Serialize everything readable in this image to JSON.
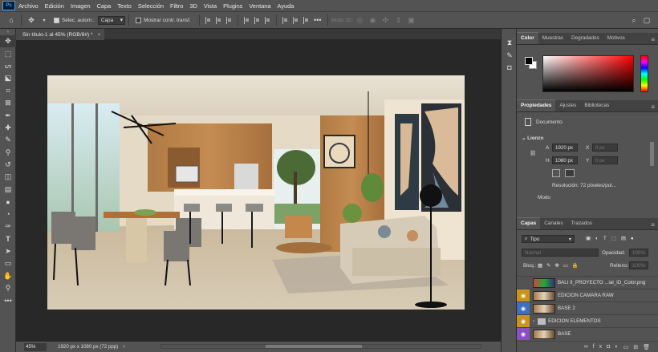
{
  "menu": [
    "Archivo",
    "Edición",
    "Imagen",
    "Capa",
    "Texto",
    "Selección",
    "Filtro",
    "3D",
    "Vista",
    "Plugins",
    "Ventana",
    "Ayuda"
  ],
  "options": {
    "auto_select_label": "Selec. autom.:",
    "auto_select_value": "Capa",
    "transform_label": "Mostrar contr. transf.",
    "mode3d_label": "Modo 3D:"
  },
  "document": {
    "tab_title": "Sin título-1 al 45% (RGB/8#) *",
    "zoom": "45%",
    "size_info": "1920 px x 1080 px (72 ppp)"
  },
  "color_panel": {
    "tabs": [
      "Color",
      "Muestras",
      "Degradados",
      "Motivos"
    ],
    "fg": "#000000",
    "bg": "#ffffff"
  },
  "properties_panel": {
    "tabs": [
      "Propiedades",
      "Ajustes",
      "Bibliotecas"
    ],
    "doc_label": "Documento",
    "section": "Lienzo",
    "w_label": "A",
    "w_value": "1920 px",
    "h_label": "H",
    "h_value": "1080 px",
    "x_label": "X",
    "x_value": "0 px",
    "y_label": "Y",
    "y_value": "0 px",
    "resolution": "Resolución: 72 píxeles/pul...",
    "mode_label": "Modo"
  },
  "layers_panel": {
    "tabs": [
      "Capas",
      "Canales",
      "Trazados"
    ],
    "filter": "Tipo",
    "blend": "Normal",
    "opacity_label": "Opacidad:",
    "opacity_value": "100%",
    "lock_label": "Bloq.:",
    "fill_label": "Relleno:",
    "fill_value": "100%",
    "layers": [
      {
        "name": "BALI II_PROYECTO ...ial_ID_Color.png",
        "eye_color": "#535353",
        "visible": false,
        "type": "image"
      },
      {
        "name": "EDICION CAMARA RAW",
        "eye_color": "#c9931c",
        "visible": true,
        "type": "image"
      },
      {
        "name": "BASE 2",
        "eye_color": "#3e6fc2",
        "visible": true,
        "type": "image"
      },
      {
        "name": "EDICION ELEMENTOS",
        "eye_color": "#c9931c",
        "visible": true,
        "type": "folder"
      },
      {
        "name": "BASE",
        "eye_color": "#8b4fc4",
        "visible": true,
        "type": "image"
      }
    ]
  }
}
